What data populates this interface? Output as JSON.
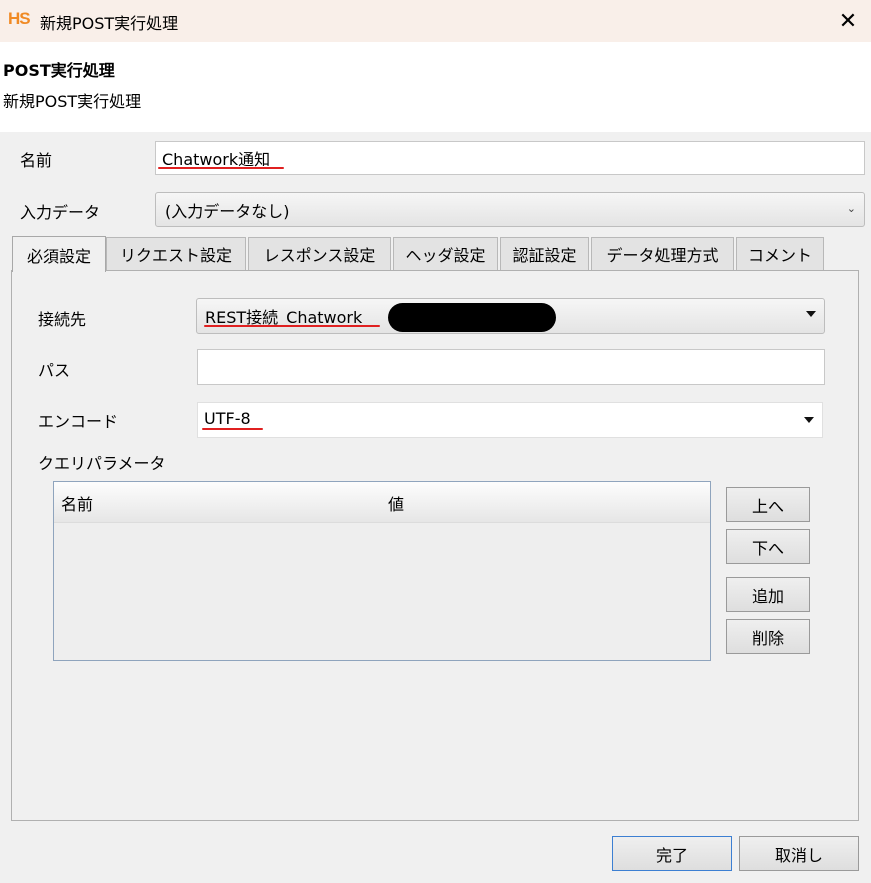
{
  "window": {
    "logo": "HS",
    "title": "新規POST実行処理",
    "close_icon": "close-icon"
  },
  "header": {
    "title": "POST実行処理",
    "subtitle": "新規POST実行処理"
  },
  "form": {
    "name_label": "名前",
    "name_value": "Chatwork通知",
    "input_data_label": "入力データ",
    "input_data_value": "(入力データなし)"
  },
  "tabs": [
    {
      "label": "必須設定",
      "active": true
    },
    {
      "label": "リクエスト設定",
      "active": false
    },
    {
      "label": "レスポンス設定",
      "active": false
    },
    {
      "label": "ヘッダ設定",
      "active": false
    },
    {
      "label": "認証設定",
      "active": false
    },
    {
      "label": "データ処理方式",
      "active": false
    },
    {
      "label": "コメント",
      "active": false
    }
  ],
  "required": {
    "connection_label": "接続先",
    "connection_value": "REST接続_Chatwork",
    "path_label": "パス",
    "path_value": "",
    "encoding_label": "エンコード",
    "encoding_value": "UTF-8",
    "query_params_label": "クエリパラメータ",
    "table": {
      "columns": [
        "名前",
        "値"
      ],
      "rows": []
    },
    "buttons": {
      "up": "上へ",
      "down": "下へ",
      "add": "追加",
      "delete": "削除"
    }
  },
  "footer": {
    "ok": "完了",
    "cancel": "取消し"
  },
  "colors": {
    "accent": "#f08a24",
    "underline": "#e02020",
    "titlebar": "#f9efe9"
  }
}
